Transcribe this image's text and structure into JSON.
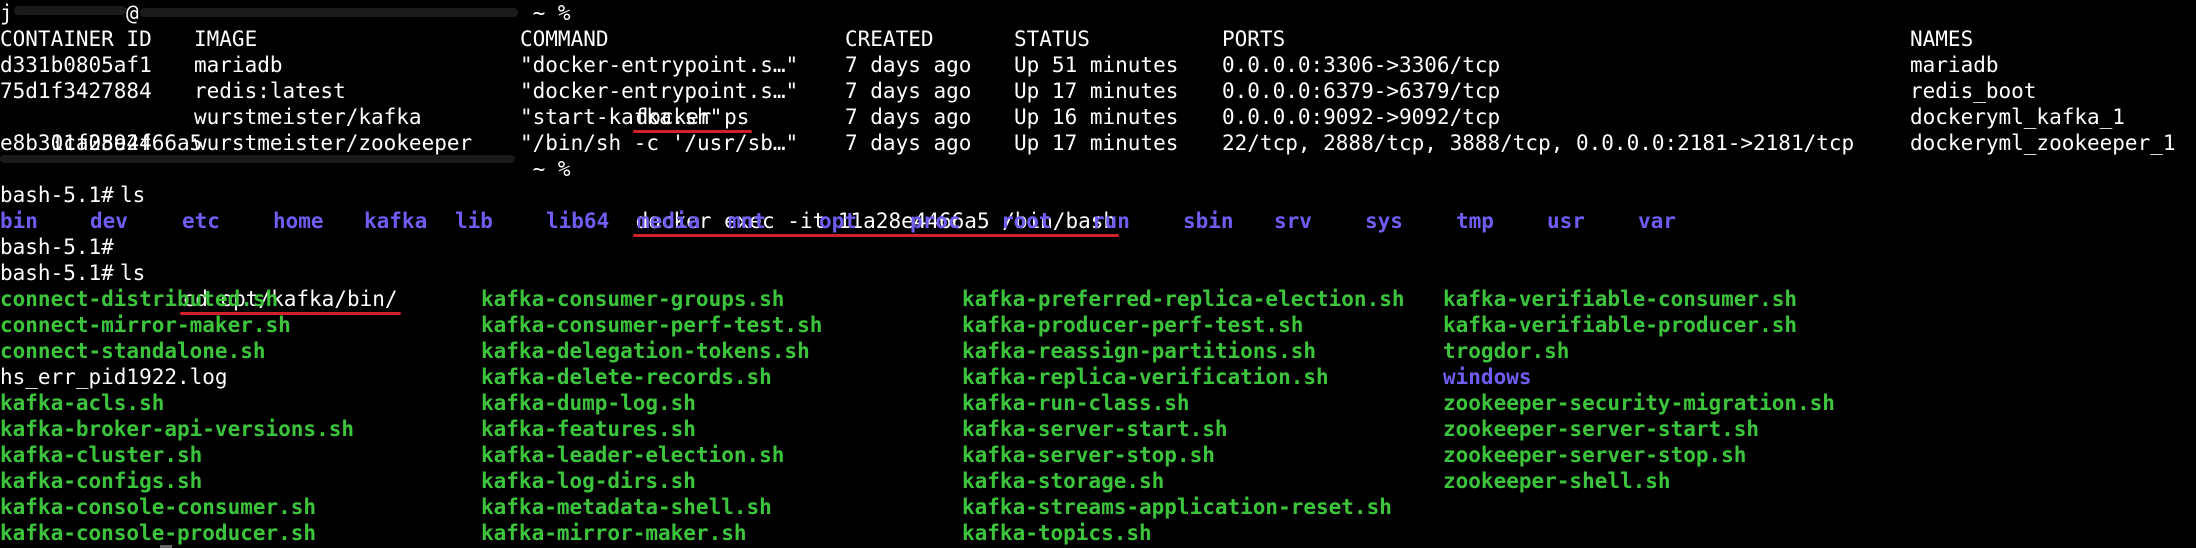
{
  "terminal": {
    "prompt1": {
      "user_prefix": "j",
      "host_fragment_a": "@",
      "suffix": " ~ %",
      "command": "docker ps"
    },
    "ps_headers": [
      "CONTAINER ID",
      "IMAGE",
      "COMMAND",
      "CREATED",
      "STATUS",
      "PORTS",
      "NAMES"
    ],
    "ps_rows": [
      {
        "id": "d331b0805af1",
        "image": "mariadb",
        "command": "\"docker-entrypoint.s…\"",
        "created": "7 days ago",
        "status": "Up 51 minutes",
        "ports": "0.0.0.0:3306->3306/tcp",
        "names": "mariadb"
      },
      {
        "id": "75d1f3427884",
        "image": "redis:latest",
        "command": "\"docker-entrypoint.s…\"",
        "created": "7 days ago",
        "status": "Up 17 minutes",
        "ports": "0.0.0.0:6379->6379/tcp",
        "names": "redis_boot"
      },
      {
        "id": "11a28e4466a5",
        "image": "wurstmeister/kafka",
        "command": "\"start-kafka.sh\"",
        "created": "7 days ago",
        "status": "Up 16 minutes",
        "ports": "0.0.0.0:9092->9092/tcp",
        "names": "dockeryml_kafka_1"
      },
      {
        "id": "e8b30cf0592f",
        "image": "wurstmeister/zookeeper",
        "command": "\"/bin/sh -c '/usr/sb…\"",
        "created": "7 days ago",
        "status": "Up 17 minutes",
        "ports": "22/tcp, 2888/tcp, 3888/tcp, 0.0.0.0:2181->2181/tcp",
        "names": "dockeryml_zookeeper_1"
      }
    ],
    "prompt2": {
      "suffix": " ~ %",
      "command": "docker exec -it 11a28e4466a5 /bin/bash"
    },
    "bash_prompt": "bash-5.1#",
    "cmd_ls": "ls",
    "root_dirs": [
      "bin",
      "dev",
      "etc",
      "home",
      "kafka",
      "lib",
      "lib64",
      "media",
      "mnt",
      "opt",
      "proc",
      "root",
      "run",
      "sbin",
      "srv",
      "sys",
      "tmp",
      "usr",
      "var"
    ],
    "cmd_cd": "cd opt/kafka/bin/",
    "bin_files": {
      "col1": [
        {
          "name": "connect-distributed.sh",
          "kind": "exe"
        },
        {
          "name": "connect-mirror-maker.sh",
          "kind": "exe"
        },
        {
          "name": "connect-standalone.sh",
          "kind": "exe"
        },
        {
          "name": "hs_err_pid1922.log",
          "kind": "plain"
        },
        {
          "name": "kafka-acls.sh",
          "kind": "exe"
        },
        {
          "name": "kafka-broker-api-versions.sh",
          "kind": "exe"
        },
        {
          "name": "kafka-cluster.sh",
          "kind": "exe"
        },
        {
          "name": "kafka-configs.sh",
          "kind": "exe"
        },
        {
          "name": "kafka-console-consumer.sh",
          "kind": "exe"
        },
        {
          "name": "kafka-console-producer.sh",
          "kind": "exe"
        }
      ],
      "col2": [
        {
          "name": "kafka-consumer-groups.sh",
          "kind": "exe"
        },
        {
          "name": "kafka-consumer-perf-test.sh",
          "kind": "exe"
        },
        {
          "name": "kafka-delegation-tokens.sh",
          "kind": "exe"
        },
        {
          "name": "kafka-delete-records.sh",
          "kind": "exe"
        },
        {
          "name": "kafka-dump-log.sh",
          "kind": "exe"
        },
        {
          "name": "kafka-features.sh",
          "kind": "exe"
        },
        {
          "name": "kafka-leader-election.sh",
          "kind": "exe"
        },
        {
          "name": "kafka-log-dirs.sh",
          "kind": "exe"
        },
        {
          "name": "kafka-metadata-shell.sh",
          "kind": "exe"
        },
        {
          "name": "kafka-mirror-maker.sh",
          "kind": "exe"
        }
      ],
      "col3": [
        {
          "name": "kafka-preferred-replica-election.sh",
          "kind": "exe"
        },
        {
          "name": "kafka-producer-perf-test.sh",
          "kind": "exe"
        },
        {
          "name": "kafka-reassign-partitions.sh",
          "kind": "exe"
        },
        {
          "name": "kafka-replica-verification.sh",
          "kind": "exe"
        },
        {
          "name": "kafka-run-class.sh",
          "kind": "exe"
        },
        {
          "name": "kafka-server-start.sh",
          "kind": "exe"
        },
        {
          "name": "kafka-server-stop.sh",
          "kind": "exe"
        },
        {
          "name": "kafka-storage.sh",
          "kind": "exe"
        },
        {
          "name": "kafka-streams-application-reset.sh",
          "kind": "exe"
        },
        {
          "name": "kafka-topics.sh",
          "kind": "exe"
        }
      ],
      "col4": [
        {
          "name": "kafka-verifiable-consumer.sh",
          "kind": "exe"
        },
        {
          "name": "kafka-verifiable-producer.sh",
          "kind": "exe"
        },
        {
          "name": "trogdor.sh",
          "kind": "exe"
        },
        {
          "name": "windows",
          "kind": "dir"
        },
        {
          "name": "zookeeper-security-migration.sh",
          "kind": "exe"
        },
        {
          "name": "zookeeper-server-start.sh",
          "kind": "exe"
        },
        {
          "name": "zookeeper-server-stop.sh",
          "kind": "exe"
        },
        {
          "name": "zookeeper-shell.sh",
          "kind": "exe"
        }
      ]
    }
  },
  "colors": {
    "background": "#000000",
    "text": "#ffffff",
    "directory": "#6f5cf0",
    "executable": "#3cc43c",
    "annotation_underline": "#d2202a"
  }
}
